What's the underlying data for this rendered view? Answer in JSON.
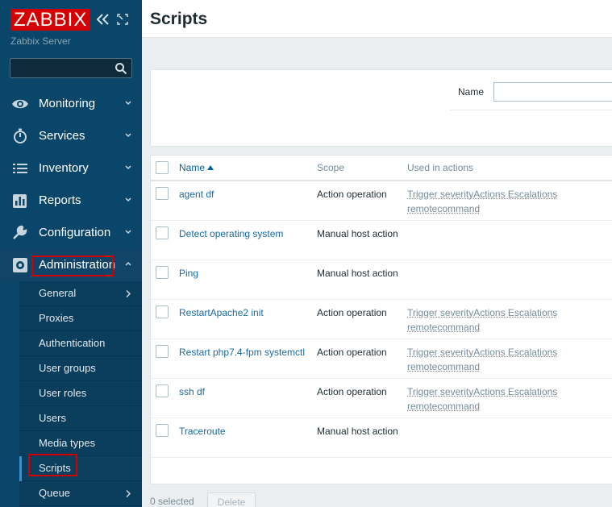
{
  "sidebar": {
    "logo": "ZABBIX",
    "server_name": "Zabbix Server",
    "search_value": "",
    "menu": [
      {
        "label": "Monitoring",
        "icon": "eye-icon"
      },
      {
        "label": "Services",
        "icon": "stopwatch-icon"
      },
      {
        "label": "Inventory",
        "icon": "list-icon"
      },
      {
        "label": "Reports",
        "icon": "bar-chart-icon"
      },
      {
        "label": "Configuration",
        "icon": "wrench-icon"
      },
      {
        "label": "Administration",
        "icon": "gear-icon"
      }
    ],
    "submenu": [
      {
        "label": "General"
      },
      {
        "label": "Proxies"
      },
      {
        "label": "Authentication"
      },
      {
        "label": "User groups"
      },
      {
        "label": "User roles"
      },
      {
        "label": "Users"
      },
      {
        "label": "Media types"
      },
      {
        "label": "Scripts"
      },
      {
        "label": "Queue"
      }
    ]
  },
  "header": {
    "title": "Scripts"
  },
  "filter": {
    "name_label": "Name",
    "name_value": ""
  },
  "table": {
    "columns": {
      "name": "Name",
      "scope": "Scope",
      "used_in_actions": "Used in actions"
    },
    "rows": [
      {
        "name": "agent df",
        "scope": "Action operation",
        "actions_line1": "Trigger severityActions Escalations",
        "actions_line2": "remotecommand"
      },
      {
        "name": "Detect operating system",
        "scope": "Manual host action",
        "actions_line1": "",
        "actions_line2": ""
      },
      {
        "name": "Ping",
        "scope": "Manual host action",
        "actions_line1": "",
        "actions_line2": ""
      },
      {
        "name": "RestartApache2 init",
        "scope": "Action operation",
        "actions_line1": "Trigger severityActions Escalations",
        "actions_line2": "remotecommand"
      },
      {
        "name": "Restart php7.4-fpm systemctl",
        "scope": "Action operation",
        "actions_line1": "Trigger severityActions Escalations",
        "actions_line2": "remotecommand"
      },
      {
        "name": "ssh df",
        "scope": "Action operation",
        "actions_line1": "Trigger severityActions Escalations",
        "actions_line2": "remotecommand"
      },
      {
        "name": "Traceroute",
        "scope": "Manual host action",
        "actions_line1": "",
        "actions_line2": ""
      }
    ]
  },
  "footer": {
    "selected": "0 selected",
    "delete_label": "Delete"
  },
  "colors": {
    "sidebar_bg": "#0a466a",
    "brand_red": "#d40000",
    "link": "#0a5f9a",
    "highlight_box": "#d40000"
  }
}
